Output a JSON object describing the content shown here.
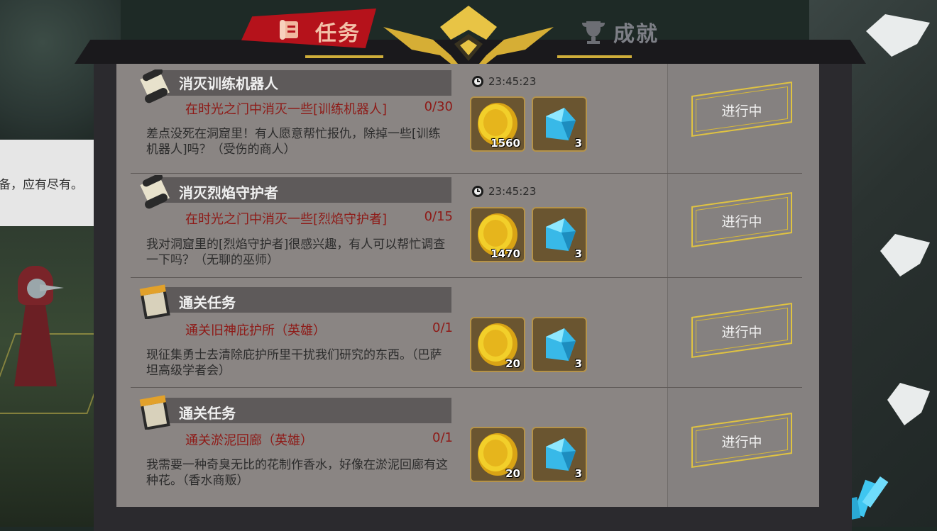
{
  "tabs": {
    "task_label": "任务",
    "achievement_label": "成就",
    "active": "task"
  },
  "npc_dialog": {
    "text": "备，应有尽有。"
  },
  "quests": [
    {
      "icon": "scroll-icon",
      "title": "消灭训练机器人",
      "objective": "在时光之门中消灭一些[训练机器人]",
      "progress": "0/30",
      "description": "差点没死在洞窟里！有人愿意帮忙报仇，除掉一些[训练机器人]吗？（受伤的商人）",
      "timer": "23:45:23",
      "rewards": [
        {
          "type": "gold-coin-icon",
          "qty": "1560"
        },
        {
          "type": "blue-gem-icon",
          "qty": "3"
        }
      ],
      "status": "进行中"
    },
    {
      "icon": "scroll-icon",
      "title": "消灭烈焰守护者",
      "objective": "在时光之门中消灭一些[烈焰守护者]",
      "progress": "0/15",
      "description": "我对洞窟里的[烈焰守护者]很感兴趣，有人可以帮忙调查一下吗？（无聊的巫师）",
      "timer": "23:45:23",
      "rewards": [
        {
          "type": "gold-coin-icon",
          "qty": "1470"
        },
        {
          "type": "blue-gem-icon",
          "qty": "3"
        }
      ],
      "status": "进行中"
    },
    {
      "icon": "notebook-icon",
      "title": "通关任务",
      "objective": "通关旧神庇护所（英雄）",
      "progress": "0/1",
      "description": "现征集勇士去清除庇护所里干扰我们研究的东西。（巴萨坦高级学者会）",
      "timer": "",
      "rewards": [
        {
          "type": "gold-coin-icon",
          "qty": "20"
        },
        {
          "type": "blue-gem-icon",
          "qty": "3"
        }
      ],
      "status": "进行中"
    },
    {
      "icon": "notebook-icon",
      "title": "通关任务",
      "objective": "通关淤泥回廊（英雄）",
      "progress": "0/1",
      "description": "我需要一种奇臭无比的花制作香水，好像在淤泥回廊有这种花。（香水商贩）",
      "timer": "",
      "rewards": [
        {
          "type": "gold-coin-icon",
          "qty": "20"
        },
        {
          "type": "blue-gem-icon",
          "qty": "3"
        }
      ],
      "status": "进行中"
    }
  ],
  "colors": {
    "panel": "#8a8583",
    "tab_active": "#b5121b",
    "objective_text": "#8e1a17",
    "button_gold": "#e0c341"
  }
}
